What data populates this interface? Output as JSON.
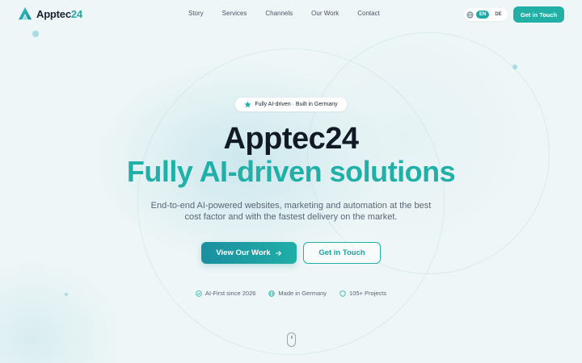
{
  "brand": {
    "name_main": "Apptec",
    "name_accent": "24",
    "accent_color": "#1fa9a6"
  },
  "nav": {
    "links": [
      "Story",
      "Services",
      "Channels",
      "Our Work",
      "Contact"
    ],
    "languages": [
      "EN",
      "DE"
    ],
    "active_language": "EN",
    "cta_label": "Get in Touch"
  },
  "hero": {
    "badge_text": "Fully AI-driven · Built in Germany",
    "title": "Apptec24",
    "subtitle": "Fully AI-driven solutions",
    "description": "End-to-end AI-powered websites, marketing and automation at the best cost factor and with the fastest delivery on the market.",
    "primary_button": "View Our Work",
    "secondary_button": "Get in Touch",
    "features": [
      {
        "icon": "check-circle-icon",
        "label": "AI-First since 2026"
      },
      {
        "icon": "globe-icon",
        "label": "Made in Germany"
      },
      {
        "icon": "shield-icon",
        "label": "105+ Projects"
      }
    ]
  }
}
